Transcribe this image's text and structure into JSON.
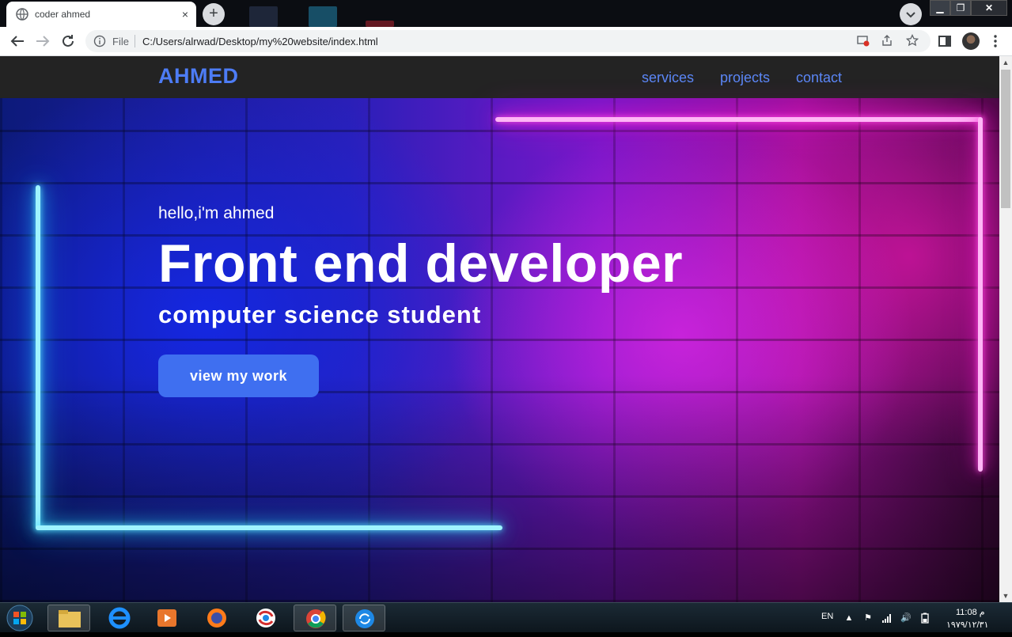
{
  "browser": {
    "tab_title": "coder ahmed",
    "tab_close": "×",
    "new_tab": "+",
    "omnibox_scheme_label": "File",
    "url": "C:/Users/alrwad/Desktop/my%20website/index.html",
    "window_controls": {
      "minimize": "▁",
      "maximize": "❐",
      "close": "✕"
    }
  },
  "site": {
    "brand": "AHMED",
    "nav": [
      "services",
      "projects",
      "contact"
    ],
    "hero": {
      "greeting": "hello,i'm ahmed",
      "headline": "Front end developer",
      "subheadline": "computer science student",
      "cta_label": "view my work"
    },
    "colors": {
      "brand": "#4d7cf5",
      "nav_link": "#5b86f6",
      "cta": "#3f6ff0",
      "neon_blue": "#2bd2ff",
      "neon_pink": "#ff1fd0"
    }
  },
  "taskbar": {
    "language": "EN",
    "time": "11:08 م",
    "date": "١٩٧٩/١٢/٣١",
    "pinned_apps": [
      "windows-explorer",
      "internet-explorer",
      "media-player",
      "firefox",
      "browser-app",
      "chrome",
      "sync-app"
    ]
  }
}
